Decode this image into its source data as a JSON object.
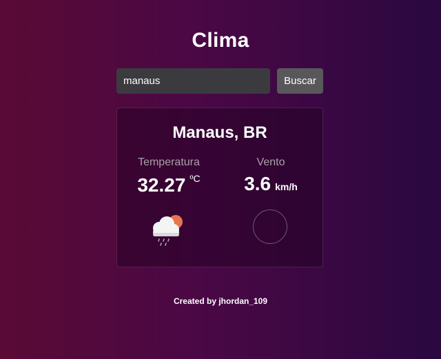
{
  "app": {
    "title": "Clima"
  },
  "search": {
    "value": "manaus",
    "button_label": "Buscar"
  },
  "weather": {
    "city": "Manaus, BR",
    "temperature": {
      "label": "Temperatura",
      "value": "32.27",
      "unit": "ºC"
    },
    "wind": {
      "label": "Vento",
      "value": "3.6",
      "unit": "km/h"
    },
    "condition_icon": "cloud-sun-rain-icon",
    "wind_direction_icon": "wind-compass-icon"
  },
  "footer": {
    "text": "Created by jhordan_109"
  },
  "colors": {
    "background_left": "#5a0a35",
    "background_right": "#2a0840",
    "input_bg": "#3b3b3f",
    "button_bg": "#58585b",
    "label": "#a9a0aa"
  }
}
